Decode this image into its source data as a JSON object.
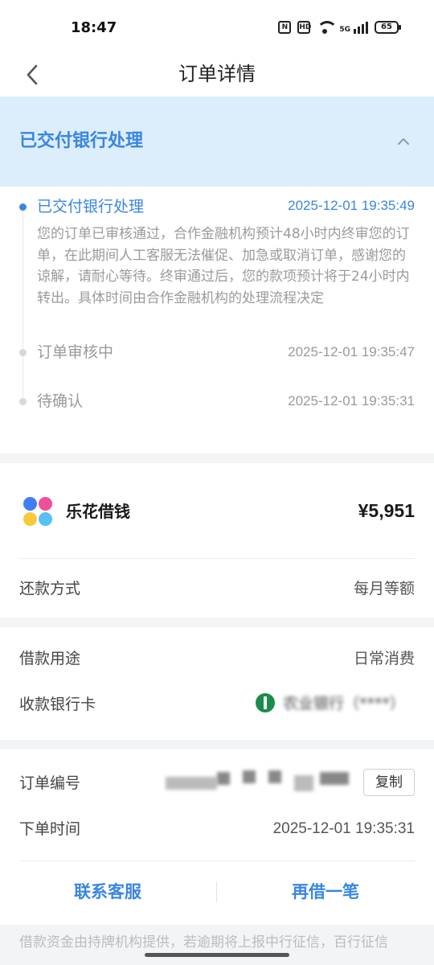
{
  "status_bar": {
    "time": "18:47",
    "battery": "65",
    "network": "5G"
  },
  "nav": {
    "title": "订单详情",
    "back_icon": "chevron-left-icon"
  },
  "status_header": {
    "title": "已交付银行处理",
    "toggle_icon": "chevron-up-icon"
  },
  "timeline": [
    {
      "label": "已交付银行处理",
      "time": "2025-12-01 19:35:49",
      "active": true,
      "description": "您的订单已审核通过，合作金融机构预计48小时内终审您的订单，在此期间人工客服无法催促、加急或取消订单，感谢您的谅解，请耐心等待。终审通过后，您的款项预计将于24小时内转出。具体时间由合作金融机构的处理流程决定"
    },
    {
      "label": "订单审核中",
      "time": "2025-12-01 19:35:47",
      "active": false
    },
    {
      "label": "待确认",
      "time": "2025-12-01 19:35:31",
      "active": false
    }
  ],
  "loan": {
    "product_name": "乐花借钱",
    "amount": "¥5,951",
    "repayment_label": "还款方式",
    "repayment_value": "每月等额"
  },
  "details": {
    "purpose_label": "借款用途",
    "purpose_value": "日常消费",
    "bank_label": "收款银行卡",
    "bank_value": "农业银行（****）"
  },
  "order": {
    "number_label": "订单编号",
    "copy_label": "复制",
    "time_label": "下单时间",
    "time_value": "2025-12-01 19:35:31"
  },
  "actions": {
    "contact": "联系客服",
    "borrow_again": "再借一笔"
  },
  "footer_note": "借款资金由持牌机构提供，若逾期将上报中行征信，百行征信",
  "colors": {
    "accent": "#3a86e0",
    "header_bg": "#dcedfb",
    "bank_green": "#1c8c4c"
  }
}
